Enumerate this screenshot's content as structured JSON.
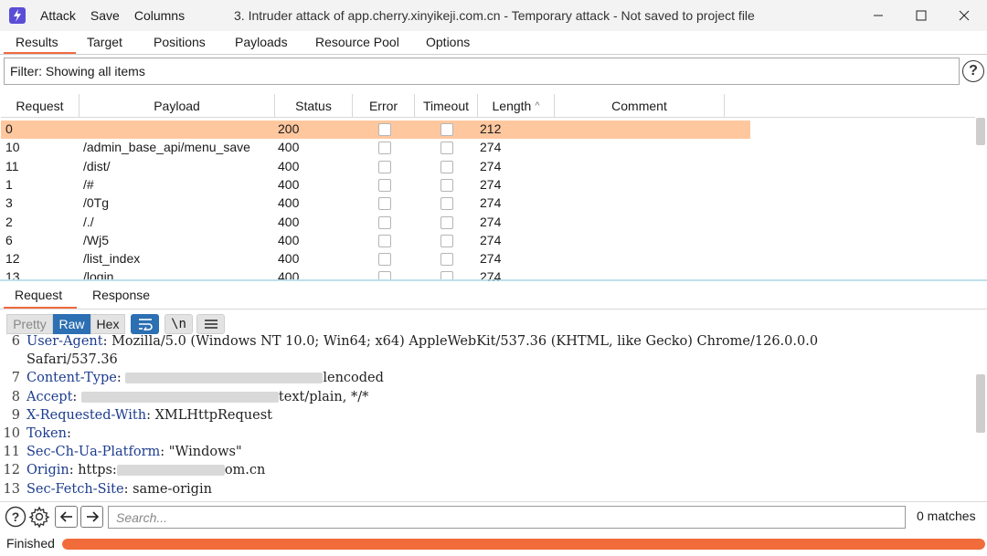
{
  "titlebar": {
    "menu": [
      "Attack",
      "Save",
      "Columns"
    ],
    "title": "3. Intruder attack of app.cherry.xinyikeji.com.cn - Temporary attack - Not saved to project file",
    "controls": [
      "minimize-icon",
      "maximize-icon",
      "close-icon"
    ]
  },
  "tabs": [
    "Results",
    "Target",
    "Positions",
    "Payloads",
    "Resource Pool",
    "Options"
  ],
  "active_tab": "Results",
  "filter": {
    "text": "Filter: Showing all items"
  },
  "help_glyph": "?",
  "table": {
    "columns": [
      "Request",
      "Payload",
      "Status",
      "Error",
      "Timeout",
      "Length",
      "Comment"
    ],
    "sort_indicator": "^",
    "rows": [
      {
        "request": "0",
        "payload": "",
        "status": "200",
        "length": "212",
        "selected": true
      },
      {
        "request": "10",
        "payload": "/admin_base_api/menu_save",
        "status": "400",
        "length": "274"
      },
      {
        "request": "11",
        "payload": "/dist/",
        "status": "400",
        "length": "274"
      },
      {
        "request": "1",
        "payload": "/#",
        "status": "400",
        "length": "274"
      },
      {
        "request": "3",
        "payload": "/0Tg",
        "status": "400",
        "length": "274"
      },
      {
        "request": "2",
        "payload": "/./",
        "status": "400",
        "length": "274"
      },
      {
        "request": "6",
        "payload": "/Wj5",
        "status": "400",
        "length": "274"
      },
      {
        "request": "12",
        "payload": "/list_index",
        "status": "400",
        "length": "274"
      },
      {
        "request": "13",
        "payload": "/login",
        "status": "400",
        "length": "274"
      }
    ]
  },
  "message_tabs": [
    "Request",
    "Response"
  ],
  "active_message_tab": "Request",
  "view_modes": [
    "Pretty",
    "Raw",
    "Hex"
  ],
  "active_view_mode": "Raw",
  "toolbar_icons": {
    "wrap": "wrap-lines-icon",
    "newline_label": "\\n",
    "menu": "menu-icon"
  },
  "editor_lines": [
    {
      "num": "6",
      "key": "User-Agent",
      "sep": ": ",
      "value": "Mozilla/5.0 (Windows NT 10.0; Win64; x64) AppleWebKit/537.36 (KHTML, like Gecko) Chrome/126.0.0.0"
    },
    {
      "num": "",
      "key": "",
      "sep": "",
      "value": "Safari/537.36"
    },
    {
      "num": "7",
      "key": "Content-Type",
      "sep": ": ",
      "value": "lencoded",
      "redacted": true
    },
    {
      "num": "8",
      "key": "Accept",
      "sep": ": ",
      "value": "text/plain, */*",
      "redacted": true
    },
    {
      "num": "9",
      "key": "X-Requested-With",
      "sep": ": ",
      "value": "XMLHttpRequest"
    },
    {
      "num": "10",
      "key": "Token",
      "sep": ":",
      "value": ""
    },
    {
      "num": "11",
      "key": "Sec-Ch-Ua-Platform",
      "sep": ": ",
      "value": "\"Windows\""
    },
    {
      "num": "12",
      "key": "Origin",
      "sep": ": ",
      "value": "https:",
      "value_tail": "om.cn",
      "redacted": true
    },
    {
      "num": "13",
      "key": "Sec-Fetch-Site",
      "sep": ": ",
      "value": "same-origin"
    }
  ],
  "search": {
    "placeholder": "Search...",
    "value": "",
    "matches": "0 matches"
  },
  "status": {
    "text": "Finished",
    "progress": 1.0
  },
  "colors": {
    "accent": "#f06b3f",
    "selected_row": "#ffc79e",
    "raw_button": "#2c6fb3",
    "progress": "#f26b3a",
    "header_key": "#1d3c8f"
  }
}
